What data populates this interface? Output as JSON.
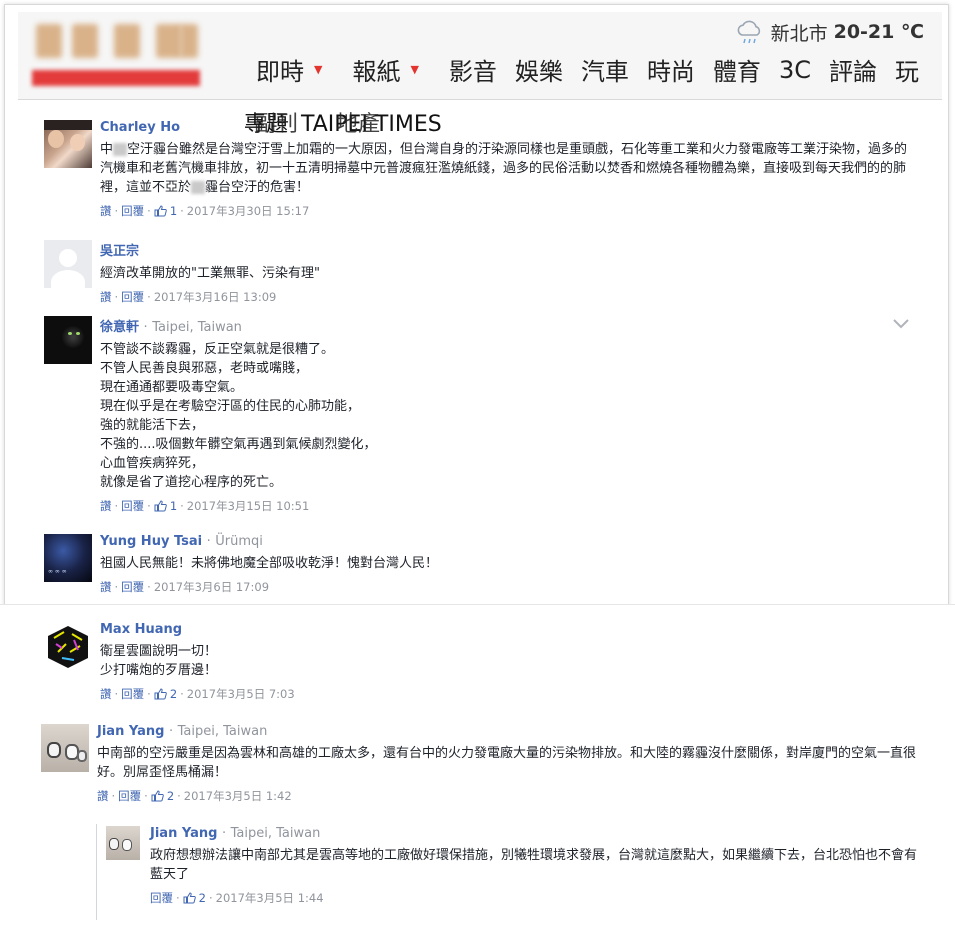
{
  "header": {
    "weather": {
      "city": "新北市",
      "temp": "20-21 ℃",
      "icon": "cloud-rain-icon"
    },
    "nav": [
      {
        "label": "即時",
        "has_dropdown": true
      },
      {
        "label": "報紙",
        "has_dropdown": true
      },
      {
        "label": "影音",
        "has_dropdown": false
      },
      {
        "label": "娛樂",
        "has_dropdown": false
      },
      {
        "label": "汽車",
        "has_dropdown": false
      },
      {
        "label": "時尚",
        "has_dropdown": false
      },
      {
        "label": "體育",
        "has_dropdown": false
      },
      {
        "label": "3C",
        "has_dropdown": false
      },
      {
        "label": "評論",
        "has_dropdown": false
      },
      {
        "label": "玩",
        "has_dropdown": false
      }
    ]
  },
  "overlay": {
    "line1": "專題",
    "line2": "TAIPEI TIMES",
    "line3": "副刊",
    "line4": "地產"
  },
  "comments": [
    {
      "name": "Charley Ho",
      "location": "",
      "text_a": "中",
      "text_b": "空汙霾台雖然是台灣空汙雪上加霜的一大原因，但台灣自身的汙染源同樣也是重頭戲，石化等重工業和火力發電廠等工業汙染物，過多的汽機車和老舊汽機車排放，初一十五清明掃墓中元普渡瘋狂濫燒紙錢，過多的民俗活動以焚香和燃燒各種物體為樂，直接吸到每天我們的的肺裡，這並不亞於",
      "text_c": "霾台空汙的危害！",
      "like": "讚",
      "reply": "回覆",
      "likes": "1",
      "date": "2017年3月30日 15:17"
    },
    {
      "name": "吳正宗",
      "location": "",
      "text": "經濟改革開放的\"工業無罪、污染有理\"",
      "like": "讚",
      "reply": "回覆",
      "likes": "",
      "date": "2017年3月16日 13:09"
    },
    {
      "name": "徐意軒",
      "location": "Taipei, Taiwan",
      "text": "不管談不談霧霾，反正空氣就是很糟了。\n不管人民善良與邪惡，老時或嘴賤，\n現在通通都要吸毒空氣。\n現在似乎是在考驗空汙區的住民的心肺功能，\n強的就能活下去，\n不強的....吸個數年髒空氣再遇到氣候劇烈變化，\n心血管疾病猝死，\n就像是省了道挖心程序的死亡。",
      "like": "讚",
      "reply": "回覆",
      "likes": "1",
      "date": "2017年3月15日 10:51"
    },
    {
      "name": "Yung Huy Tsai",
      "location": "Ürümqi",
      "text": "祖國人民無能！未將佛地魔全部吸收乾淨！愧對台灣人民！",
      "like": "讚",
      "reply": "回覆",
      "likes": "",
      "date": "2017年3月6日 17:09"
    },
    {
      "name": "Max Huang",
      "location": "",
      "text": "衛星雲圖說明一切！\n少打嘴炮的歹厝邊！",
      "like": "讚",
      "reply": "回覆",
      "likes": "2",
      "date": "2017年3月5日 7:03"
    },
    {
      "name": "Jian Yang",
      "location": "Taipei, Taiwan",
      "text": "中南部的空污嚴重是因為雲林和高雄的工廠太多，還有台中的火力發電廠大量的污染物排放。和大陸的霧霾沒什麼關係，對岸廈門的空氣一直很好。別屌歪怪馬桶漏！",
      "like": "讚",
      "reply": "回覆",
      "likes": "2",
      "date": "2017年3月5日 1:42"
    },
    {
      "name": "Jian Yang",
      "location": "Taipei, Taiwan",
      "text": "政府想想辦法讓中南部尤其是雲高等地的工廠做好環保措施，別犧牲環境求發展，台灣就這麼點大，如果繼續下去，台北恐怕也不會有藍天了",
      "like": "",
      "reply": "回覆",
      "likes": "2",
      "date": "2017年3月5日 1:44"
    }
  ],
  "sep": "·"
}
